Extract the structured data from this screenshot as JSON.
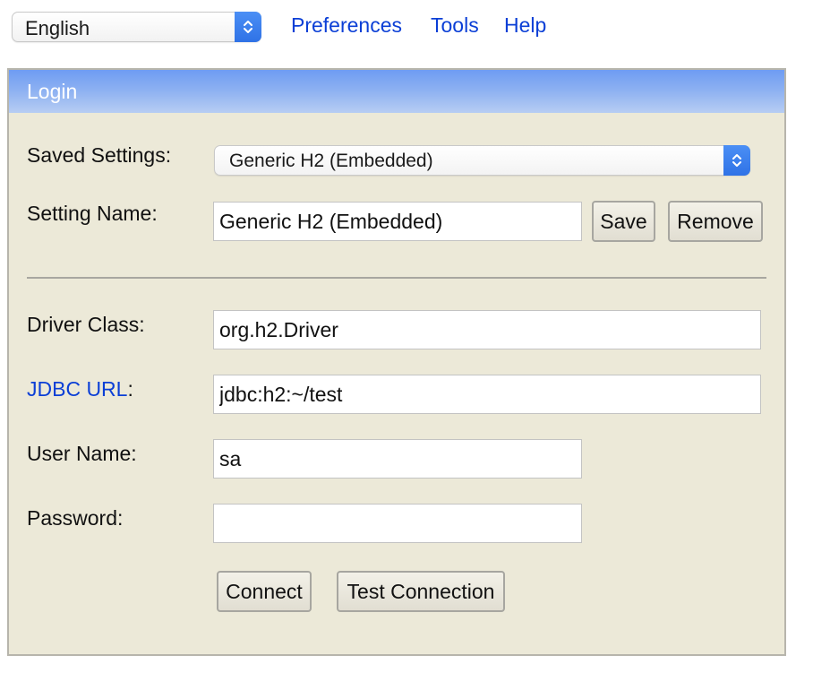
{
  "topbar": {
    "language": "English",
    "links": {
      "preferences": "Preferences",
      "tools": "Tools",
      "help": "Help"
    }
  },
  "login": {
    "header": "Login",
    "saved_settings": {
      "label": "Saved Settings:",
      "value": "Generic H2 (Embedded)"
    },
    "setting_name": {
      "label": "Setting Name:",
      "value": "Generic H2 (Embedded)",
      "save_label": "Save",
      "remove_label": "Remove"
    },
    "driver_class": {
      "label": "Driver Class:",
      "value": "org.h2.Driver"
    },
    "jdbc_url": {
      "link_label": "JDBC URL",
      "suffix": ":",
      "value": "jdbc:h2:~/test"
    },
    "user_name": {
      "label": "User Name:",
      "value": "sa"
    },
    "password": {
      "label": "Password:",
      "value": ""
    },
    "connect_label": "Connect",
    "test_connection_label": "Test Connection"
  },
  "colors": {
    "link": "#0b3fd6",
    "panel_bg": "#ece9d8",
    "header_gradient_top": "#6e9cf3",
    "select_accent": "#2f72e6"
  }
}
